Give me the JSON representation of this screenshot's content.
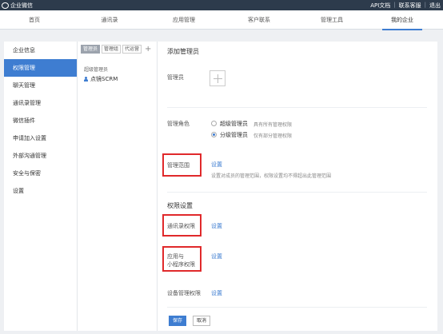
{
  "topbar": {
    "app_name": "企业微信",
    "links": [
      "API文档",
      "联系客服",
      "退出"
    ]
  },
  "nav": {
    "tabs": [
      "首页",
      "通讯录",
      "应用管理",
      "客户联系",
      "管理工具",
      "我的企业"
    ],
    "active": "我的企业"
  },
  "left_menu": {
    "items": [
      "企业信息",
      "权限管理",
      "聊天管理",
      "通讯录管理",
      "微信插件",
      "申请加入设置",
      "外部沟通管理",
      "安全与保密",
      "设置"
    ],
    "active": "权限管理"
  },
  "mid_panel": {
    "tabs": [
      "管理员",
      "管理组",
      "代运营"
    ],
    "active_tab": "管理员",
    "add_icon": "plus-icon",
    "group_label": "超级管理员",
    "member_name": "点镜SCRM"
  },
  "main": {
    "title": "添加管理员",
    "admin_label": "管理员",
    "role_label": "管理角色",
    "role_options": [
      {
        "label": "超级管理员",
        "desc": "具有所有管理权限",
        "selected": false
      },
      {
        "label": "分级管理员",
        "desc": "仅有部分管理权限",
        "selected": true
      }
    ],
    "scope_label": "管理范围",
    "scope_link": "设置",
    "scope_desc": "设置对成员的管理范围，权限设置均不得超出此管理范围",
    "perm_section": "权限设置",
    "contacts_perm_label": "通讯录权限",
    "contacts_perm_link": "设置",
    "app_perm_label_line1": "应用与",
    "app_perm_label_line2": "小程序权限",
    "app_perm_link": "设置",
    "device_perm_label": "设备管理权限",
    "device_perm_link": "设置",
    "save_label": "保存",
    "cancel_label": "取消"
  },
  "colors": {
    "accent": "#3e7dd1",
    "topbar_bg": "#2d3b4c",
    "highlight_red": "#e0292b"
  }
}
